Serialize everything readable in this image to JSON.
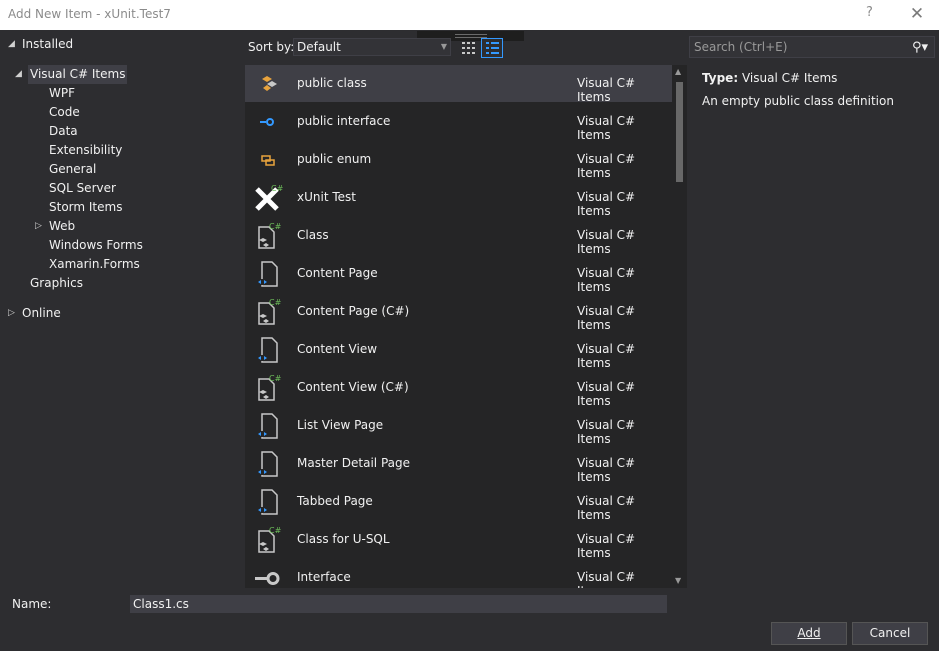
{
  "window": {
    "title": "Add New Item - xUnit.Test7",
    "help_glyph": "?",
    "close_glyph": "✕"
  },
  "tree": {
    "installed": "Installed",
    "visual_csharp": "Visual C# Items",
    "children": [
      "WPF",
      "Code",
      "Data",
      "Extensibility",
      "General",
      "SQL Server",
      "Storm Items",
      "Web",
      "Windows Forms",
      "Xamarin.Forms"
    ],
    "graphics": "Graphics",
    "online": "Online"
  },
  "toolbar": {
    "sort_label": "Sort by:",
    "sort_value": "Default",
    "search_placeholder": "Search (Ctrl+E)"
  },
  "items": [
    {
      "name": "public class",
      "category": "Visual C# Items",
      "icon": "class-member-icon"
    },
    {
      "name": "public interface",
      "category": "Visual C# Items",
      "icon": "interface-member-icon"
    },
    {
      "name": "public enum",
      "category": "Visual C# Items",
      "icon": "enum-member-icon"
    },
    {
      "name": "xUnit Test",
      "category": "Visual C# Items",
      "icon": "xunit-icon"
    },
    {
      "name": "Class",
      "category": "Visual C# Items",
      "icon": "csharp-class-file-icon"
    },
    {
      "name": "Content Page",
      "category": "Visual C# Items",
      "icon": "xaml-page-icon"
    },
    {
      "name": "Content Page (C#)",
      "category": "Visual C# Items",
      "icon": "csharp-class-file-icon"
    },
    {
      "name": "Content View",
      "category": "Visual C# Items",
      "icon": "xaml-page-icon"
    },
    {
      "name": "Content View (C#)",
      "category": "Visual C# Items",
      "icon": "csharp-class-file-icon"
    },
    {
      "name": "List View Page",
      "category": "Visual C# Items",
      "icon": "xaml-page-icon"
    },
    {
      "name": "Master Detail Page",
      "category": "Visual C# Items",
      "icon": "xaml-page-icon"
    },
    {
      "name": "Tabbed Page",
      "category": "Visual C# Items",
      "icon": "xaml-page-icon"
    },
    {
      "name": "Class for U-SQL",
      "category": "Visual C# Items",
      "icon": "csharp-class-file-icon"
    },
    {
      "name": "Interface",
      "category": "Visual C# Items",
      "icon": "interface-icon"
    }
  ],
  "details": {
    "type_label": "Type:",
    "type_value": "Visual C# Items",
    "description": "An empty public class definition"
  },
  "footer": {
    "name_label": "Name:",
    "name_value": "Class1.cs",
    "add_label": "Add",
    "cancel_label": "Cancel"
  },
  "colors": {
    "background": "#2d2d30",
    "list_background": "#252526",
    "selection": "#3f3f46",
    "accent": "#3399ff",
    "csharp_badge": "#6dbd5a"
  }
}
